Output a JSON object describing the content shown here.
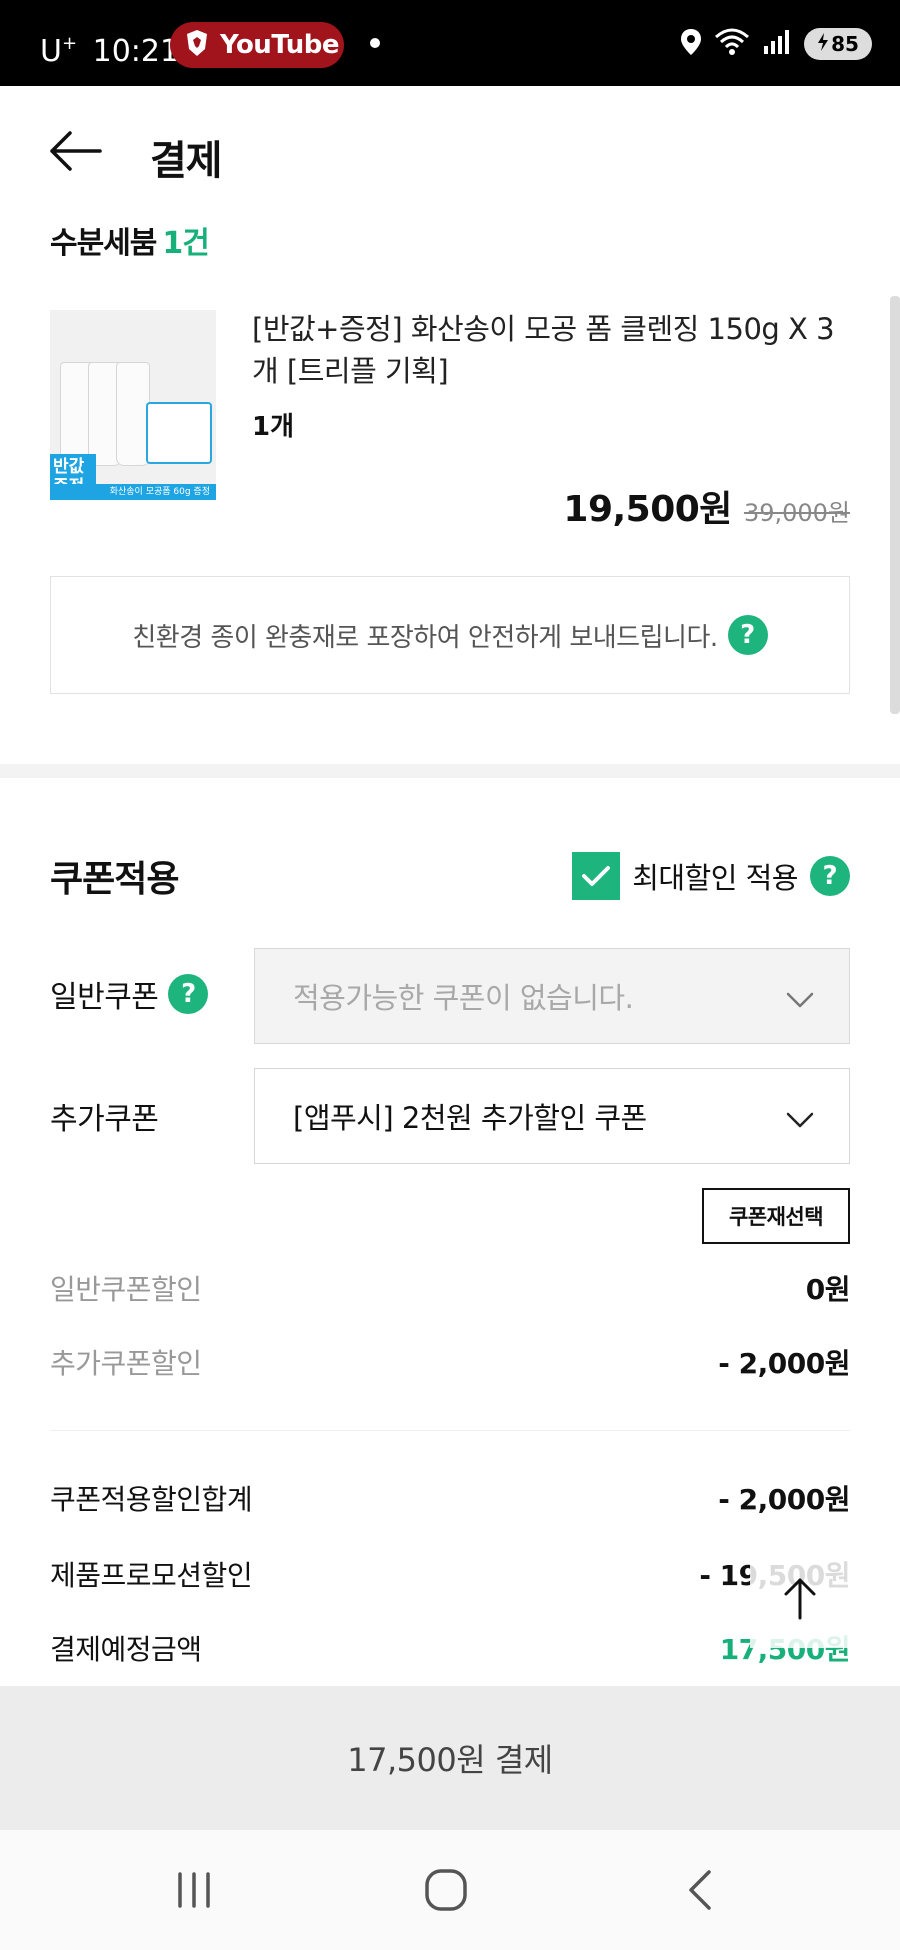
{
  "status_bar": {
    "carrier": "U",
    "carrier_plus": "+",
    "time": "10:21",
    "app_pill": "YouTube",
    "battery": "85"
  },
  "header": {
    "title": "결제"
  },
  "seller": {
    "name": "수분세붐",
    "count": "1건"
  },
  "product": {
    "name": "[반값+증정] 화산송이 모공 폼 클렌징 150g X 3개 [트리플 기획]",
    "quantity": "1개",
    "price": "19,500원",
    "original_price": "39,000원",
    "thumb_badge": "반값\n증정",
    "thumb_strip": "화산송이 모공폼 60g 증정"
  },
  "eco_notice": "친환경 종이 완충재로 포장하여 안전하게 보내드립니다.",
  "coupon": {
    "title": "쿠폰적용",
    "max_discount_label": "최대할인 적용",
    "max_discount_checked": true,
    "general_label": "일반쿠폰",
    "general_placeholder": "적용가능한 쿠폰이 없습니다.",
    "extra_label": "추가쿠폰",
    "extra_value": "[앱푸시] 2천원 추가할인 쿠폰",
    "reselect_label": "쿠폰재선택"
  },
  "summary": {
    "general_discount_label": "일반쿠폰할인",
    "general_discount_value": "0원",
    "extra_discount_label": "추가쿠폰할인",
    "extra_discount_value": "- 2,000원",
    "coupon_total_label": "쿠폰적용할인합계",
    "coupon_total_value": "- 2,000원",
    "promo_label": "제품프로모션할인",
    "promo_value": "- 19,500원",
    "expected_label": "결제예정금액",
    "expected_value": "17,500원"
  },
  "pay_button": "17,500원 결제",
  "colors": {
    "accent": "#1db47d",
    "status_bar": "#000000",
    "youtube_pill": "#a2141c"
  }
}
